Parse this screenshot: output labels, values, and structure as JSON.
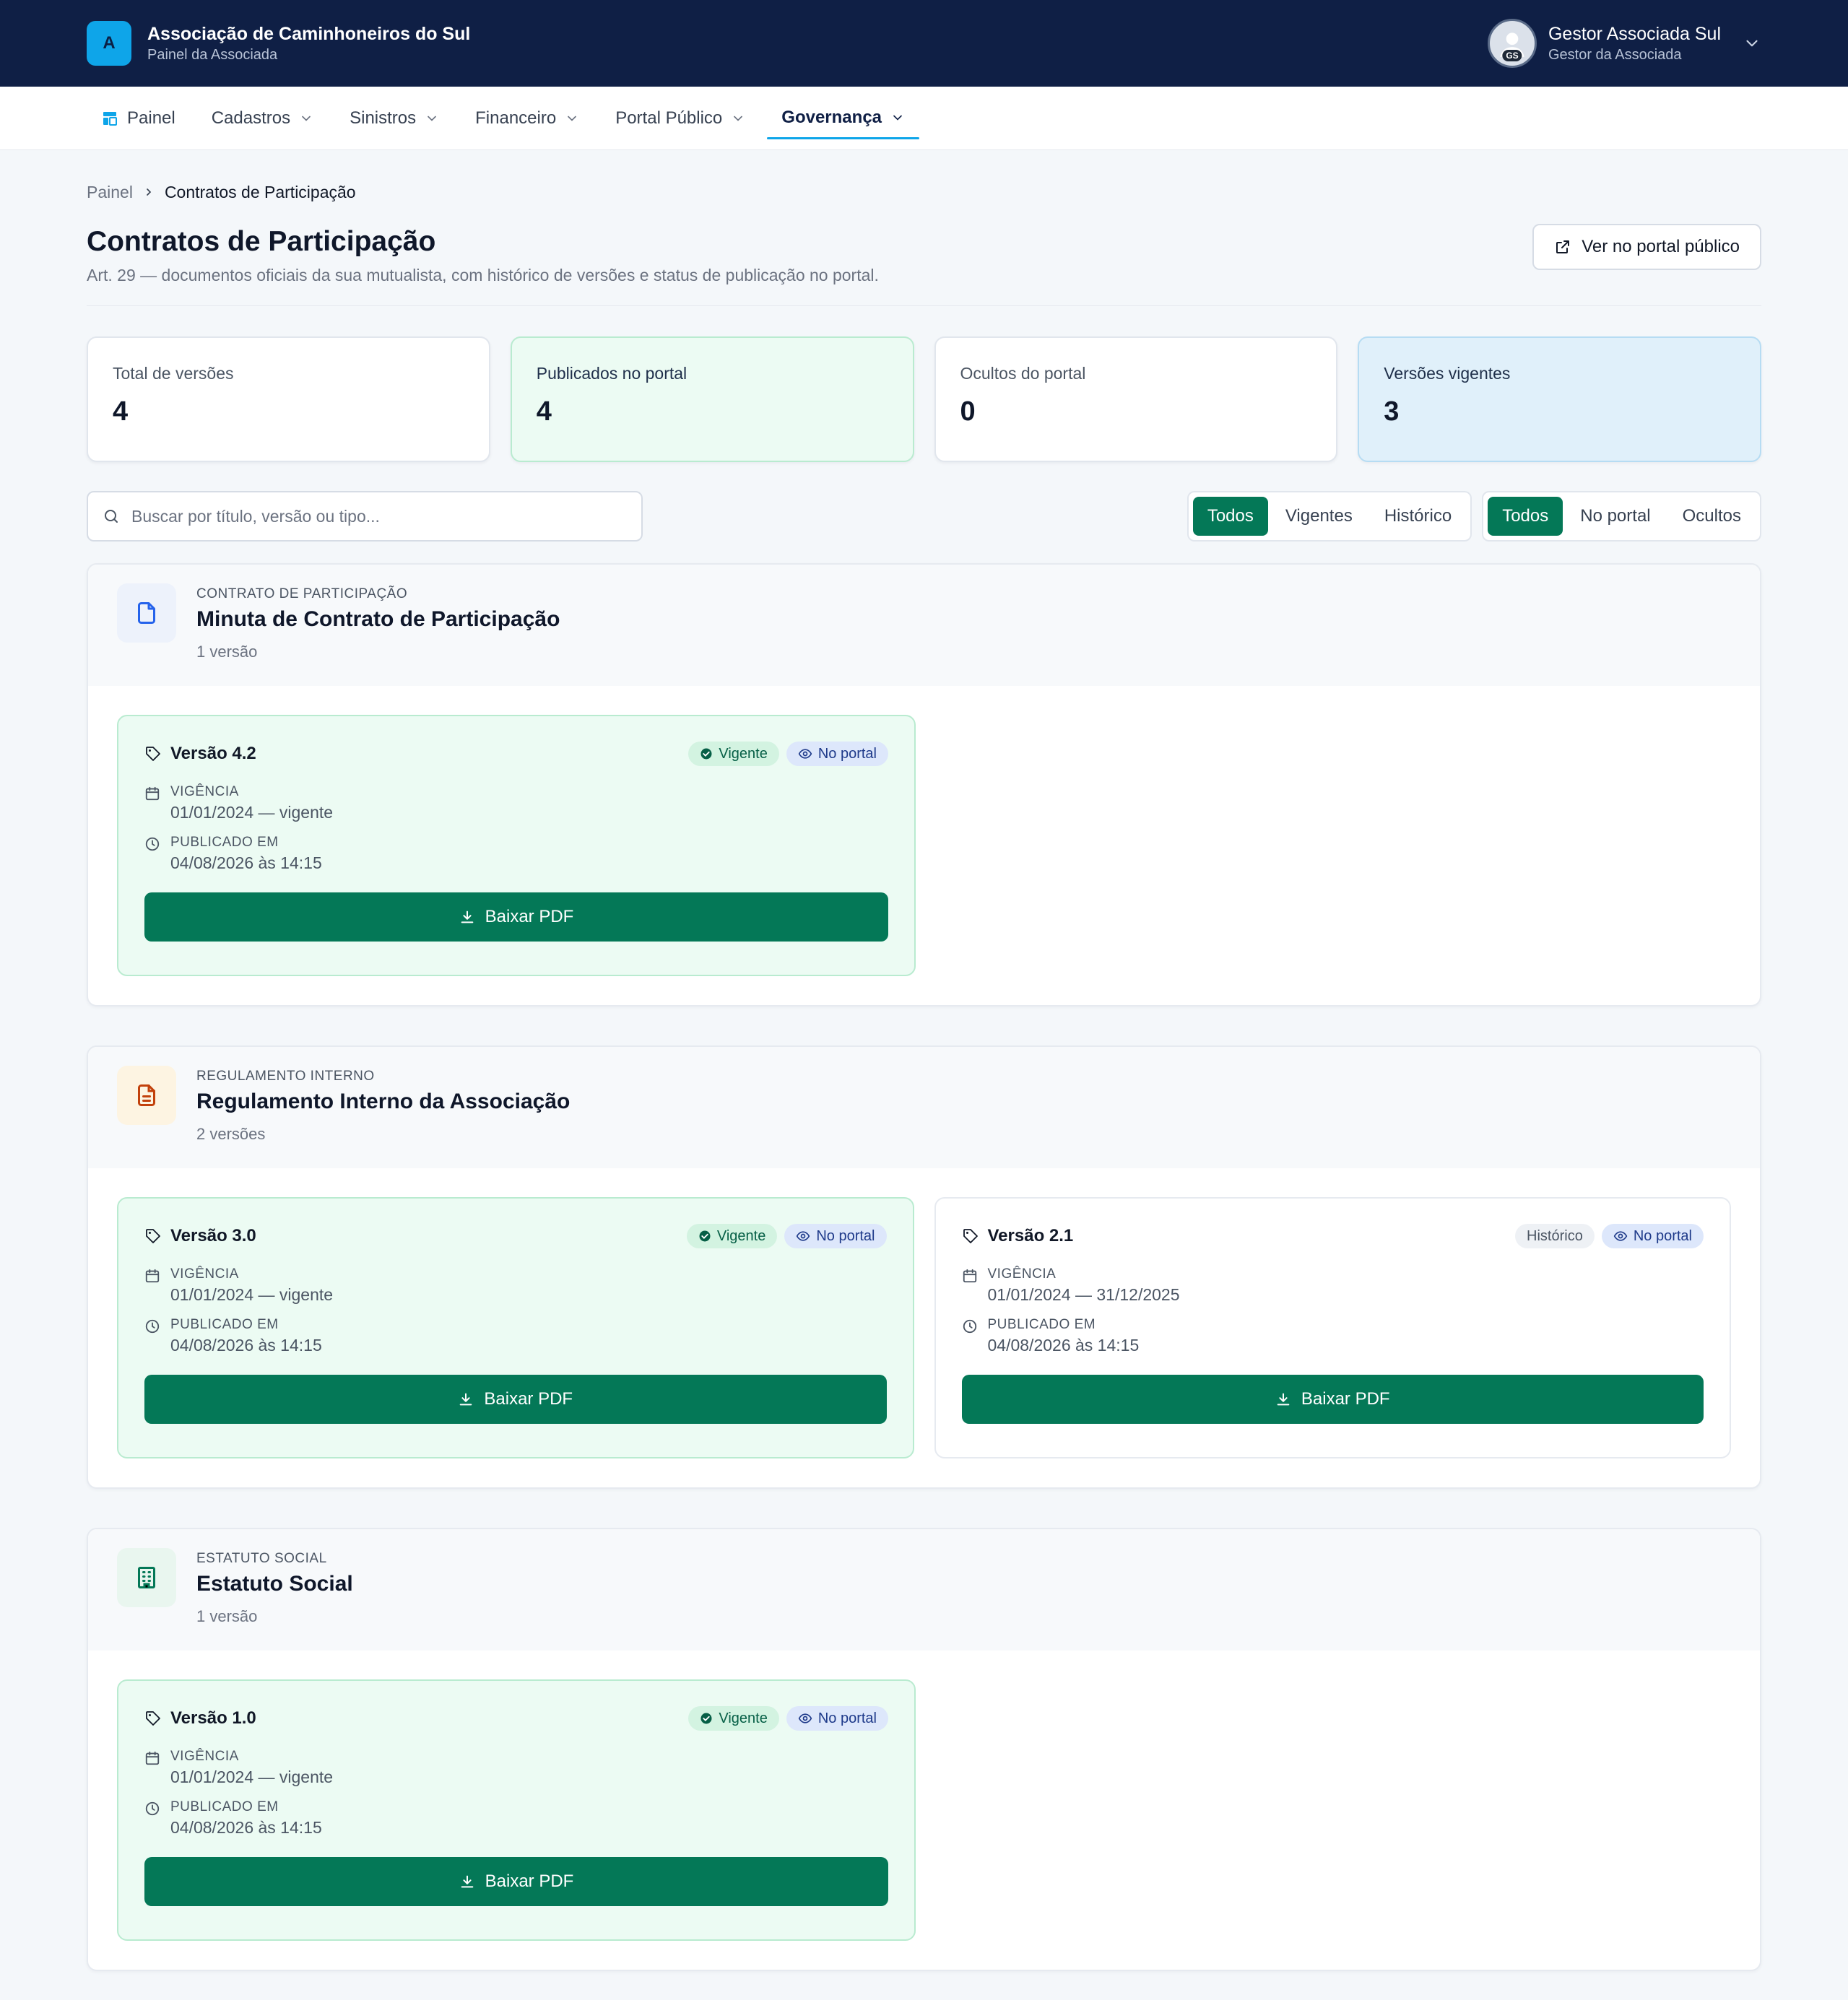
{
  "header": {
    "logo_letter": "A",
    "org_name": "Associação de Caminhoneiros do Sul",
    "org_sub": "Painel da Associada",
    "user_name": "Gestor Associada Sul",
    "user_role": "Gestor da Associada",
    "user_initials": "GS"
  },
  "nav": [
    {
      "label": "Painel"
    },
    {
      "label": "Cadastros"
    },
    {
      "label": "Sinistros"
    },
    {
      "label": "Financeiro"
    },
    {
      "label": "Portal Público"
    },
    {
      "label": "Governança"
    }
  ],
  "breadcrumb": {
    "root": "Painel",
    "current": "Contratos de Participação"
  },
  "page": {
    "title": "Contratos de Participação",
    "description": "Art. 29 — documentos oficiais da sua mutualista, com histórico de versões e status de publicação no portal.",
    "portal_button": "Ver no portal público"
  },
  "stats": [
    {
      "label": "Total de versões",
      "value": "4"
    },
    {
      "label": "Publicados no portal",
      "value": "4"
    },
    {
      "label": "Ocultos do portal",
      "value": "0"
    },
    {
      "label": "Versões vigentes",
      "value": "3"
    }
  ],
  "search": {
    "placeholder": "Buscar por título, versão ou tipo..."
  },
  "filters": {
    "status": [
      "Todos",
      "Vigentes",
      "Histórico"
    ],
    "portal": [
      "Todos",
      "No portal",
      "Ocultos"
    ]
  },
  "labels": {
    "vigencia": "VIGÊNCIA",
    "publicado": "PUBLICADO EM",
    "download": "Baixar PDF"
  },
  "groups": [
    {
      "kicker": "CONTRATO DE PARTICIPAÇÃO",
      "title": "Minuta de Contrato de Participação",
      "count": "1 versão",
      "versions": [
        {
          "name": "Versão 4.2",
          "status": "Vigente",
          "portal": "No portal",
          "vigencia": "01/01/2024 — vigente",
          "publicado": "04/08/2026 às 14:15"
        }
      ]
    },
    {
      "kicker": "REGULAMENTO INTERNO",
      "title": "Regulamento Interno da Associação",
      "count": "2 versões",
      "versions": [
        {
          "name": "Versão 3.0",
          "status": "Vigente",
          "portal": "No portal",
          "vigencia": "01/01/2024 — vigente",
          "publicado": "04/08/2026 às 14:15"
        },
        {
          "name": "Versão 2.1",
          "status": "Histórico",
          "portal": "No portal",
          "vigencia": "01/01/2024 — 31/12/2025",
          "publicado": "04/08/2026 às 14:15"
        }
      ]
    },
    {
      "kicker": "ESTATUTO SOCIAL",
      "title": "Estatuto Social",
      "count": "1 versão",
      "versions": [
        {
          "name": "Versão 1.0",
          "status": "Vigente",
          "portal": "No portal",
          "vigencia": "01/01/2024 — vigente",
          "publicado": "04/08/2026 às 14:15"
        }
      ]
    }
  ],
  "colors": {
    "topbar": "#0f1f45",
    "accent_cyan": "#0ea5e9",
    "primary_green": "#047857",
    "current_card_bg": "#ecfbf3",
    "vigentes_card_bg": "#e0f0fa"
  },
  "icons": {
    "doc_1": "file-icon",
    "doc_2": "file-text-icon",
    "doc_3": "building-icon"
  }
}
